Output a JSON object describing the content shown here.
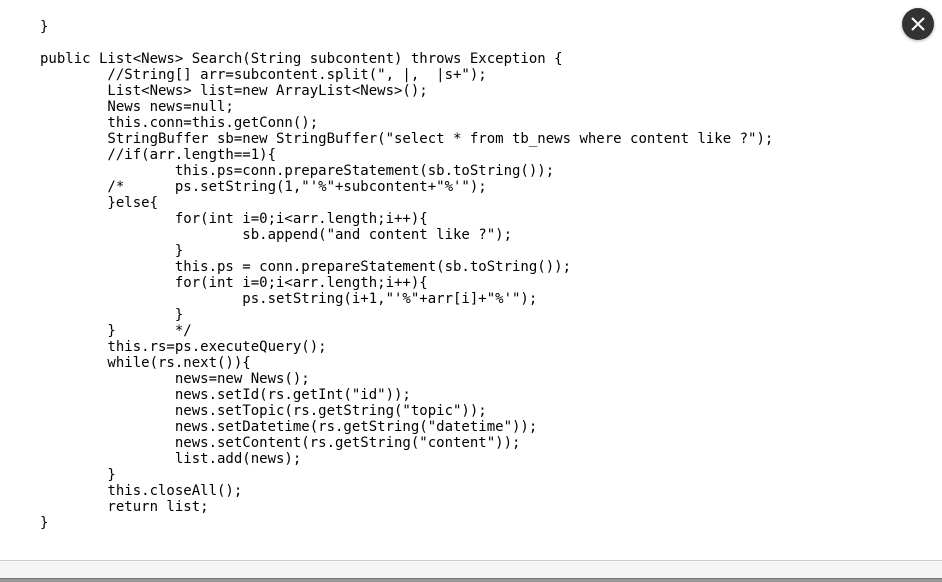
{
  "code": {
    "lines": [
      "}",
      "",
      "public List<News> Search(String subcontent) throws Exception {",
      "        //String[] arr=subcontent.split(\", |,  |s+\");",
      "        List<News> list=new ArrayList<News>();",
      "        News news=null;",
      "        this.conn=this.getConn();",
      "        StringBuffer sb=new StringBuffer(\"select * from tb_news where content like ?\");",
      "        //if(arr.length==1){",
      "                this.ps=conn.prepareStatement(sb.toString());",
      "        /*      ps.setString(1,\"'%\"+subcontent+\"%'\");",
      "        }else{",
      "                for(int i=0;i<arr.length;i++){",
      "                        sb.append(\"and content like ?\");",
      "                }",
      "                this.ps = conn.prepareStatement(sb.toString());",
      "                for(int i=0;i<arr.length;i++){",
      "                        ps.setString(i+1,\"'%\"+arr[i]+\"%'\");",
      "                }",
      "        }       */",
      "        this.rs=ps.executeQuery();",
      "        while(rs.next()){",
      "                news=new News();",
      "                news.setId(rs.getInt(\"id\"));",
      "                news.setTopic(rs.getString(\"topic\"));",
      "                news.setDatetime(rs.getString(\"datetime\"));",
      "                news.setContent(rs.getString(\"content\"));",
      "                list.add(news);",
      "        }",
      "        this.closeAll();",
      "        return list;",
      "}"
    ]
  }
}
